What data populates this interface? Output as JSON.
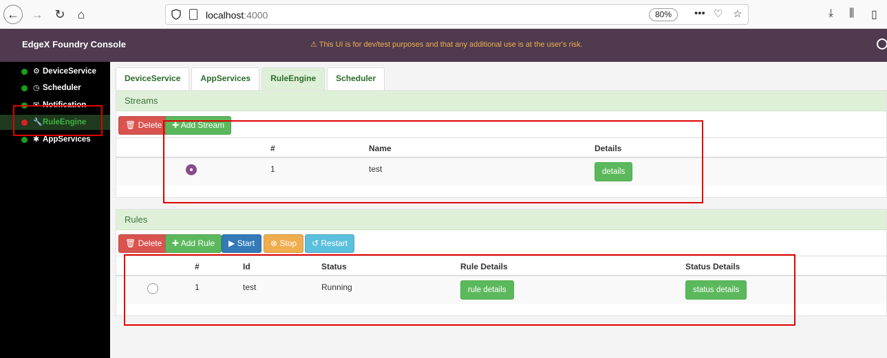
{
  "browser": {
    "url_host": "localhost",
    "url_port": ":4000",
    "zoom": "80%"
  },
  "header": {
    "title": "EdgeX Foundry Console",
    "warning": "⚠ This UI is for dev/test purposes and that any additional use is at the user's risk."
  },
  "sidebar": {
    "items": [
      {
        "label": "DeviceService",
        "icon": "⚙",
        "status": "green"
      },
      {
        "label": "Scheduler",
        "icon": "◷",
        "status": "green"
      },
      {
        "label": "Notification",
        "icon": "✉",
        "status": "green"
      },
      {
        "label": "RuleEngine",
        "icon": "🔧",
        "status": "red"
      },
      {
        "label": "AppServices",
        "icon": "✱",
        "status": "green"
      }
    ]
  },
  "tabs": [
    "DeviceService",
    "AppServices",
    "RuleEngine",
    "Scheduler"
  ],
  "streams": {
    "title": "Streams",
    "delete_label": "🗑 Delete",
    "add_label": "✚ Add Stream",
    "columns": [
      "#",
      "Name",
      "Details"
    ],
    "rows": [
      {
        "num": "1",
        "name": "test",
        "details_label": "details"
      }
    ]
  },
  "rules": {
    "title": "Rules",
    "delete_label": "🗑 Delete",
    "add_label": "✚ Add Rule",
    "start_label": "▶ Start",
    "stop_label": "⊗ Stop",
    "restart_label": "↺ Restart",
    "columns": [
      "#",
      "Id",
      "Status",
      "Rule Details",
      "Status Details"
    ],
    "rows": [
      {
        "num": "1",
        "id": "test",
        "status": "Running",
        "rule_details_label": "rule details",
        "status_details_label": "status details"
      }
    ]
  },
  "colors": {
    "header_bg": "#4f3a4f",
    "panel_head_bg": "#dff0d8",
    "danger": "#d9534f",
    "success": "#5cb85c",
    "primary": "#337ab7",
    "warning": "#f0ad4e",
    "info": "#5bc0de"
  }
}
